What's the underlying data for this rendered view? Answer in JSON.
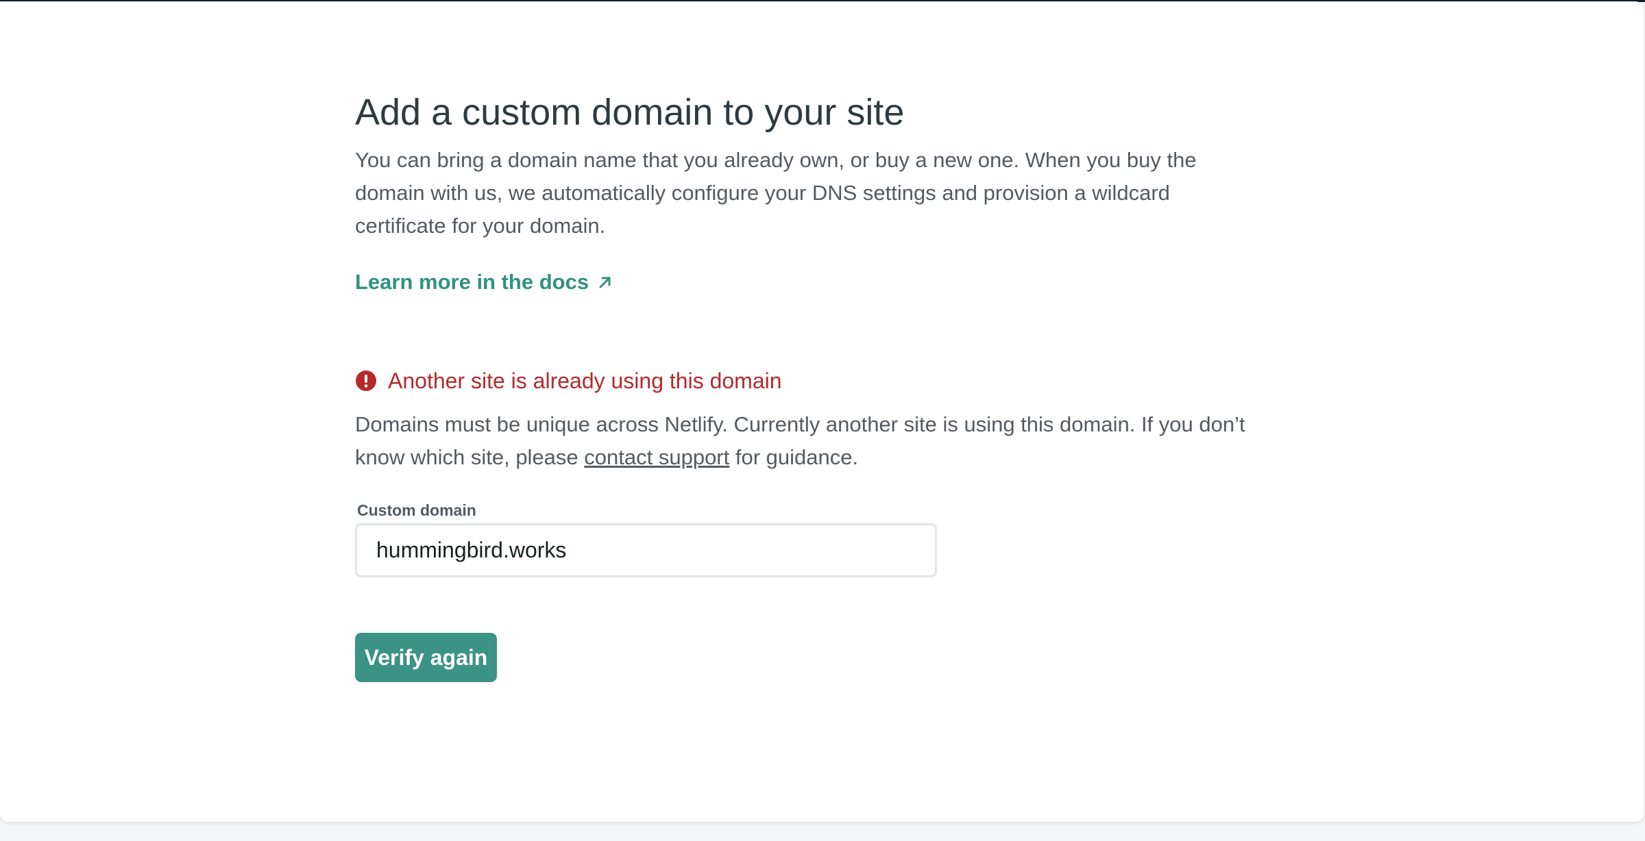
{
  "header": {
    "title": "Add a custom domain to your site",
    "description": "You can bring a domain name that you already own, or buy a new one. When you buy the domain with us, we automatically configure your DNS settings and provision a wildcard certificate for your domain."
  },
  "docs_link": {
    "label": "Learn more in the docs",
    "icon": "external-arrow-icon"
  },
  "error": {
    "icon": "exclamation-circle-icon",
    "title": "Another site is already using this domain",
    "description_before": "Domains must be unique across Netlify. Currently another site is using this domain. If you don’t know which site, please ",
    "support_link": "contact support",
    "description_after": " for guidance."
  },
  "form": {
    "label": "Custom domain",
    "value": "hummingbird.works",
    "submit_label": "Verify again"
  },
  "colors": {
    "accent": "#32917f",
    "button": "#3b9383",
    "error": "#b52a2a",
    "heading": "#2d3b41",
    "body_text": "#545a61"
  }
}
